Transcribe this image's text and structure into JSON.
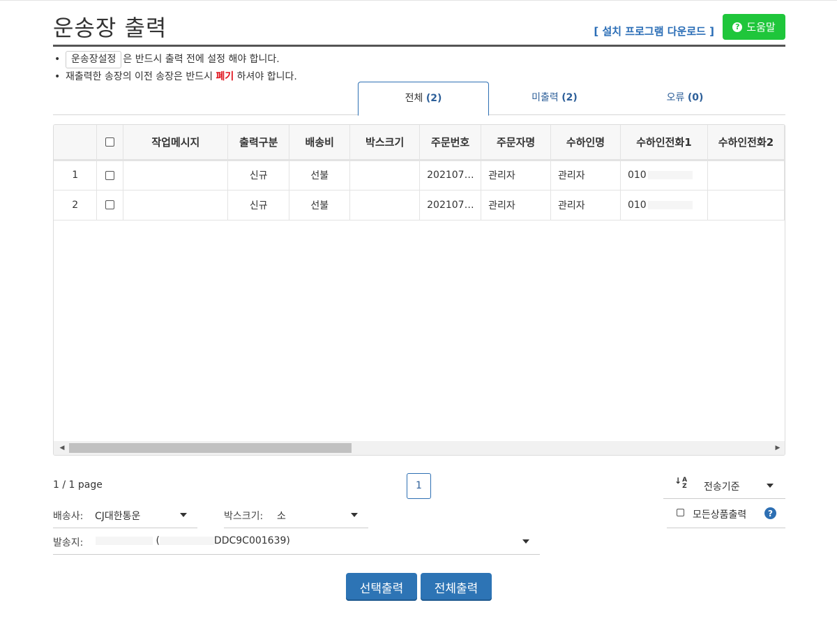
{
  "header": {
    "title": "운송장 출력",
    "download_link": "[ 설치 프로그램 다운로드 ]",
    "help_label": "도움말"
  },
  "notes": {
    "setting_button": "운송장설정",
    "line1_rest": "은 반드시 출력 전에 설정 해야 합니다.",
    "line2_a": "재출력한 송장의 이전 송장은 반드시 ",
    "line2_warn": "폐기",
    "line2_b": " 하셔야 합니다."
  },
  "tabs": [
    {
      "label": "전체",
      "count": "(2)",
      "active": true
    },
    {
      "label": "미출력",
      "count": "(2)",
      "active": false
    },
    {
      "label": "오류",
      "count": "(0)",
      "active": false
    }
  ],
  "grid": {
    "columns": [
      "",
      "",
      "작업메시지",
      "출력구분",
      "배송비",
      "박스크기",
      "주문번호",
      "주문자명",
      "수하인명",
      "수하인전화1",
      "수하인전화2"
    ],
    "rows": [
      {
        "no": "1",
        "message": "",
        "type": "신규",
        "fee": "선불",
        "box": "",
        "order_no": "202107…",
        "orderer": "관리자",
        "receiver": "관리자",
        "phone1": "010",
        "phone2": ""
      },
      {
        "no": "2",
        "message": "",
        "type": "신규",
        "fee": "선불",
        "box": "",
        "order_no": "202107…",
        "orderer": "관리자",
        "receiver": "관리자",
        "phone1": "010",
        "phone2": ""
      }
    ]
  },
  "pagination": {
    "info": "1 / 1 page",
    "current": "1"
  },
  "sort": {
    "icon_top": "A",
    "icon_bottom": "Z",
    "label": "전송기준"
  },
  "all_products": {
    "label": "모든상품출력",
    "checked": false
  },
  "carrier": {
    "label": "배송사:",
    "value": "CJ대한통운"
  },
  "box_size": {
    "label": "박스크기:",
    "value": "소"
  },
  "sender": {
    "label": "발송지:",
    "paren_open": "(",
    "value": "DDC9C001639)"
  },
  "actions": {
    "print_selected": "선택출력",
    "print_all": "전체출력"
  },
  "colors": {
    "help_green": "#1fc63b",
    "primary_blue": "#2d74b5",
    "link_blue": "#2a6db6",
    "warn_red": "#e0141e"
  }
}
